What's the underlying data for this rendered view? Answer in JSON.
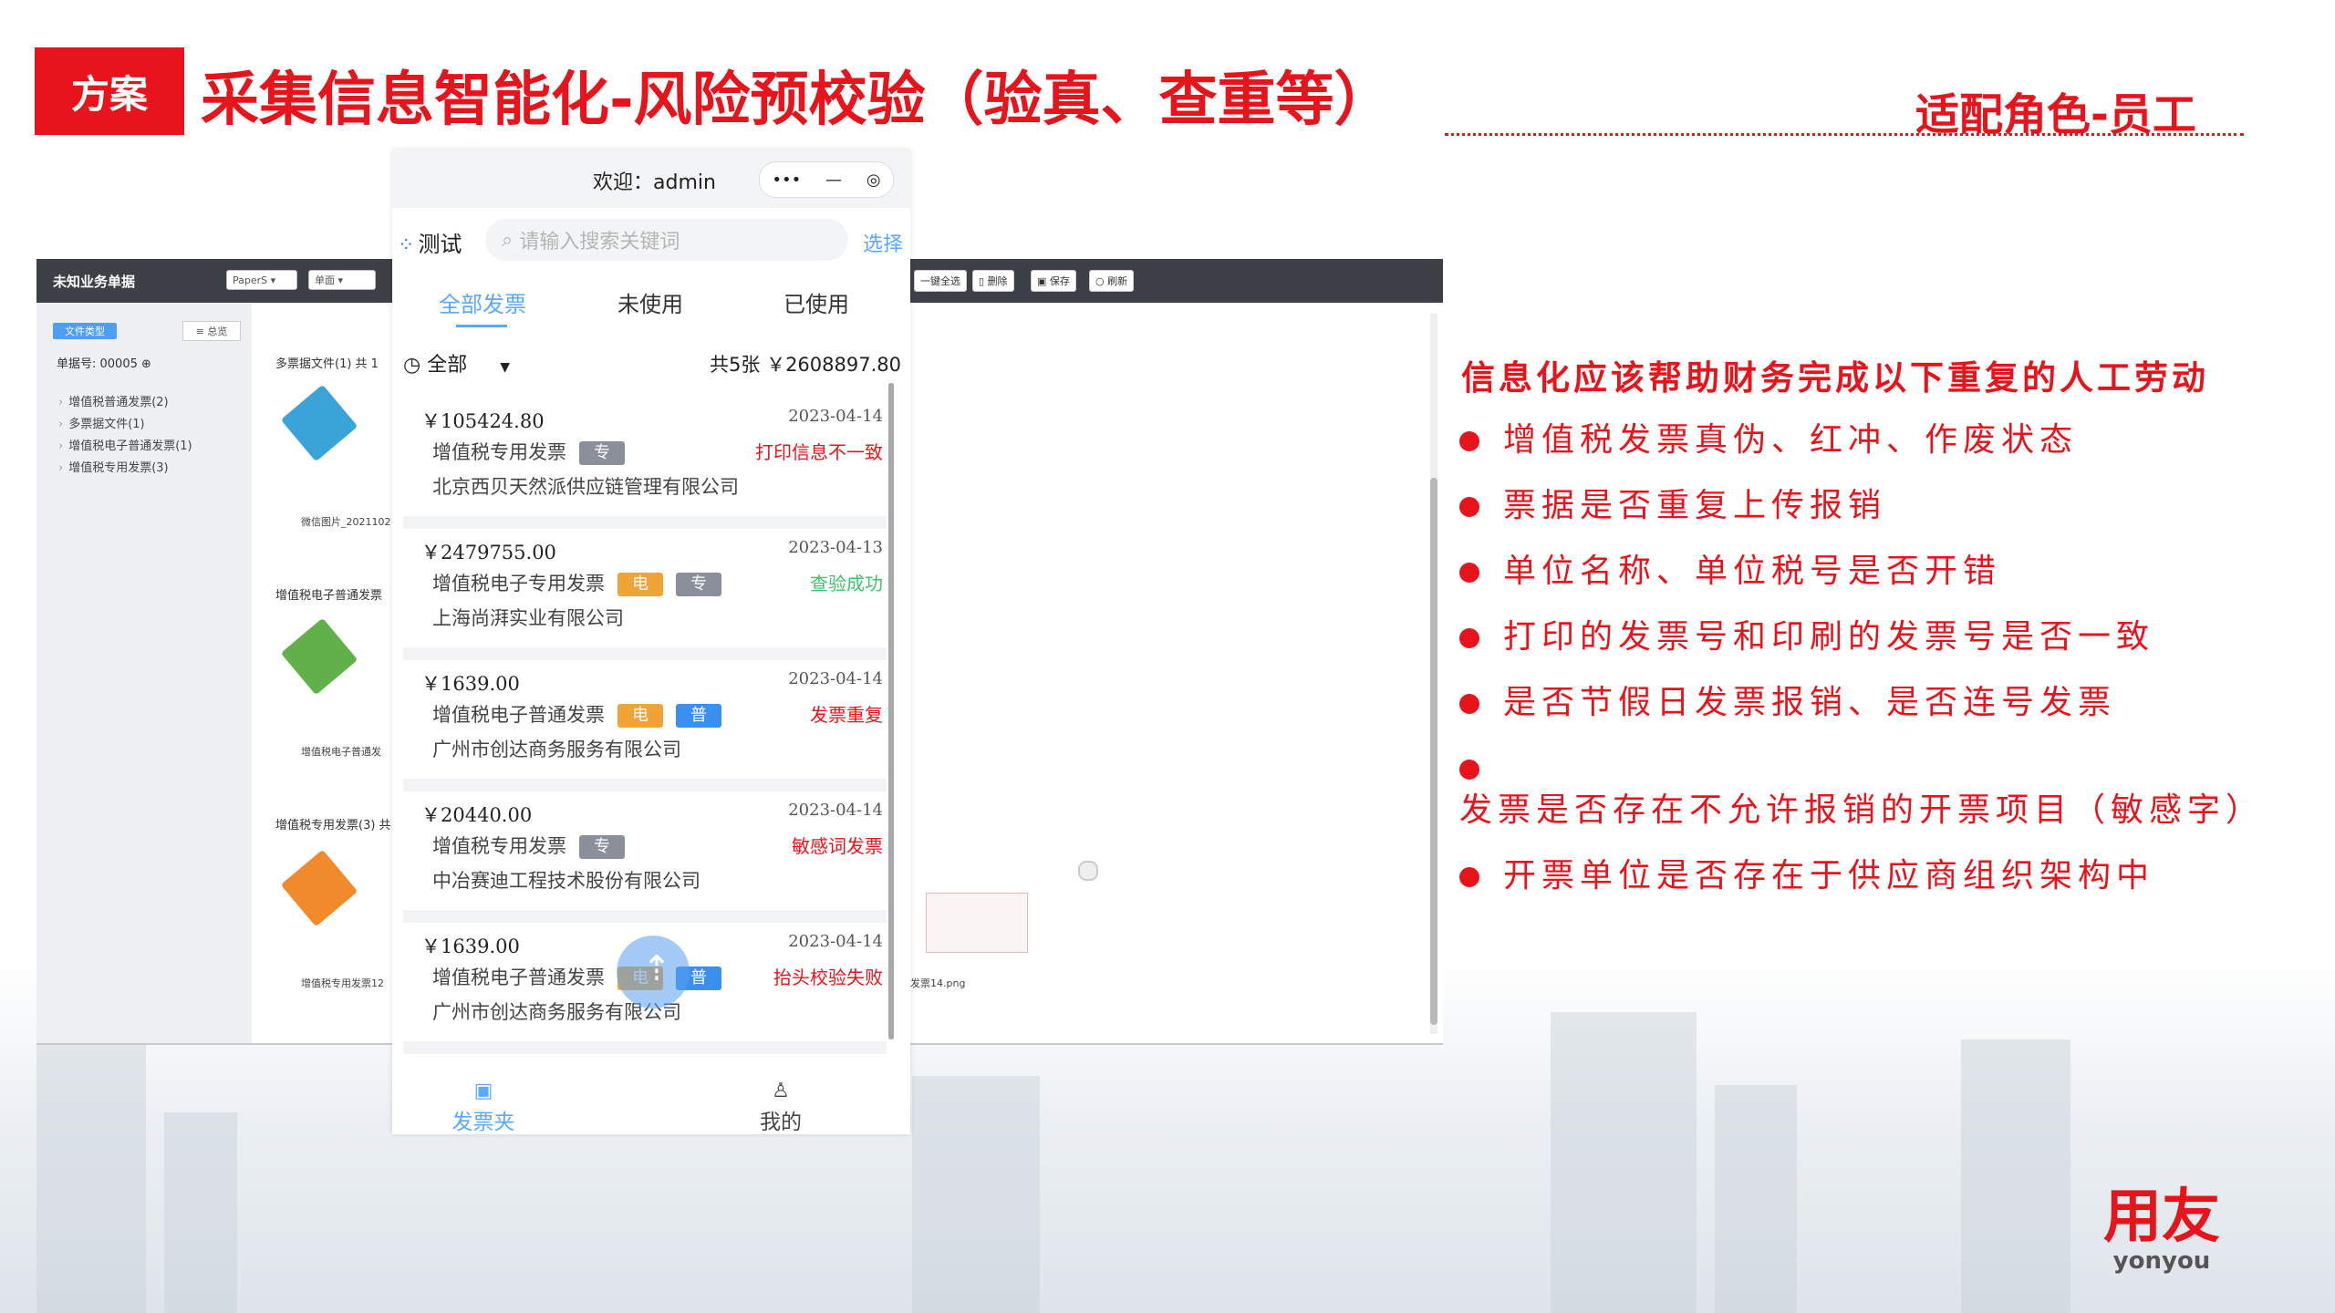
{
  "header": {
    "tag": "方案",
    "title": "采集信息智能化-风险预校验（验真、查重等）",
    "role": "适配角色-员工"
  },
  "desktop": {
    "title": "未知业务单据",
    "selects": [
      "PaperS",
      "单面"
    ],
    "toolbar_buttons": [
      "一键全选",
      "删除",
      "保存",
      "刷新"
    ],
    "sidebar": {
      "tab": "文件类型",
      "view": "总览",
      "doc_no": "单据号: 00005",
      "items": [
        "增值税普通发票(2)",
        "多票据文件(1)",
        "增值税电子普通发票(1)",
        "增值税专用发票(3)"
      ]
    },
    "groups": [
      {
        "label": "多票据文件(1) 共 1",
        "thumb": "微信图片_2021102"
      },
      {
        "label": "增值税电子普通发票",
        "thumb": "增值税电子普通发"
      },
      {
        "label": "增值税专用发票(3) 共",
        "thumb": "增值税专用发票12"
      }
    ],
    "extra_thumb": "发票14.png"
  },
  "phone": {
    "welcome": "欢迎：admin",
    "capsule_more": "•••",
    "capsule_min": "—",
    "capsule_close": "◎",
    "app_name": "测试",
    "search_placeholder": "请输入搜索关键词",
    "choose": "选择",
    "tabs": [
      "全部发票",
      "未使用",
      "已使用"
    ],
    "filter": "全部",
    "summary": "共5张  ￥2608897.80",
    "invoices": [
      {
        "amount": "￥105424.80",
        "date": "2023-04-14",
        "type": "增值税专用发票",
        "badges": [
          "专"
        ],
        "status": "打印信息不一致",
        "status_color": "red",
        "company": "北京西贝天然派供应链管理有限公司"
      },
      {
        "amount": "￥2479755.00",
        "date": "2023-04-13",
        "type": "增值税电子专用发票",
        "badges": [
          "电",
          "专"
        ],
        "status": "查验成功",
        "status_color": "green",
        "company": "上海尚湃实业有限公司"
      },
      {
        "amount": "￥1639.00",
        "date": "2023-04-14",
        "type": "增值税电子普通发票",
        "badges": [
          "电",
          "普"
        ],
        "status": "发票重复",
        "status_color": "red",
        "company": "广州市创达商务服务有限公司"
      },
      {
        "amount": "￥20440.00",
        "date": "2023-04-14",
        "type": "增值税专用发票",
        "badges": [
          "专"
        ],
        "status": "敏感词发票",
        "status_color": "red",
        "company": "中冶赛迪工程技术股份有限公司"
      },
      {
        "amount": "￥1639.00",
        "date": "2023-04-14",
        "type": "增值税电子普通发票",
        "badges": [
          "电",
          "普"
        ],
        "status": "抬头校验失败",
        "status_color": "red",
        "company": "广州市创达商务服务有限公司"
      }
    ],
    "tabbar": [
      "发票夹",
      "我的"
    ]
  },
  "right": {
    "heading": "信息化应该帮助财务完成以下重复的人工劳动",
    "bullets": [
      "增值税发票真伪、红冲、作废状态",
      "票据是否重复上传报销",
      "单位名称、单位税号是否开错",
      "打印的发票号和印刷的发票号是否一致",
      "是否节假日发票报销、是否连号发票",
      "发票是否存在不允许报销的开票项目（敏感字）",
      "开票单位是否存在于供应商组织架构中"
    ]
  },
  "logo": {
    "cn": "用友",
    "en": "yonyou"
  },
  "colors": {
    "brand_red": "#e8141c",
    "accent_blue": "#59a9ff",
    "success_green": "#3ec26b"
  }
}
